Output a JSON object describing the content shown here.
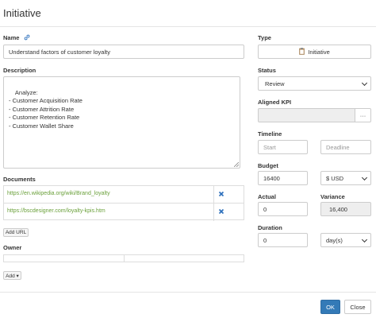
{
  "dialog": {
    "title": "Initiative"
  },
  "name": {
    "label": "Name",
    "value": "Understand factors of customer loyalty"
  },
  "description": {
    "label": "Description",
    "value": "Analyze:\n- Customer Acquisition Rate\n- Customer Attrition Rate\n- Customer Retention Rate\n- Customer Wallet Share"
  },
  "documents": {
    "label": "Documents",
    "rows": [
      {
        "url": "https://en.wikipedia.org/wiki/Brand_loyalty"
      },
      {
        "url": "https://bscdesigner.com/loyalty-kpis.htm"
      }
    ],
    "add_label": "Add URL"
  },
  "owner": {
    "label": "Owner",
    "add_label": "Add ▾"
  },
  "type": {
    "label": "Type",
    "value": "Initiative",
    "icon": "clipboard-icon"
  },
  "status": {
    "label": "Status",
    "value": "Review"
  },
  "aligned_kpi": {
    "label": "Aligned KPI",
    "button": "···"
  },
  "timeline": {
    "label": "Timeline",
    "start_placeholder": "Start",
    "deadline_placeholder": "Deadline"
  },
  "budget": {
    "label": "Budget",
    "value": "16400",
    "currency": "$ USD"
  },
  "actual": {
    "label": "Actual",
    "value": "0"
  },
  "variance": {
    "label": "Variance",
    "value": "16,400"
  },
  "duration": {
    "label": "Duration",
    "value": "0",
    "unit": "day(s)"
  },
  "footer": {
    "ok": "OK",
    "cancel": "Close"
  },
  "colors": {
    "primary": "#337ab7",
    "link": "#6aa03a",
    "remove": "#2a6ebb"
  }
}
